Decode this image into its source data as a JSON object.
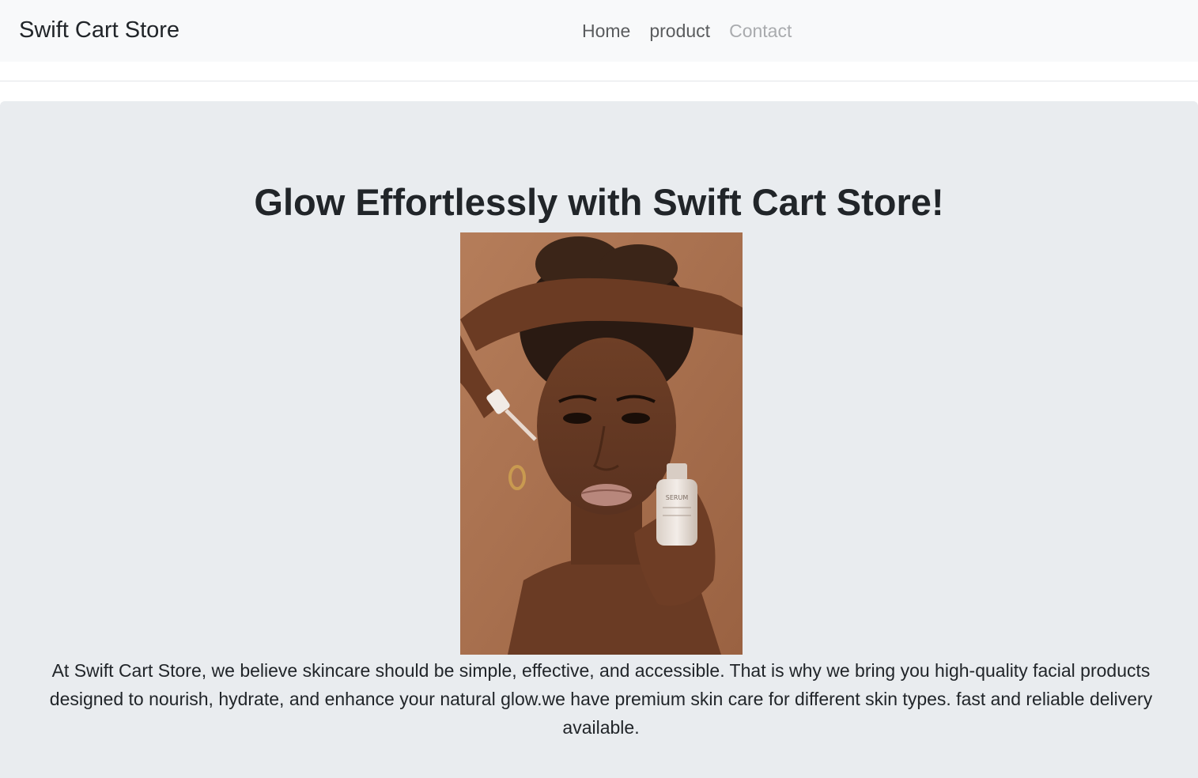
{
  "navbar": {
    "brand": "Swift Cart Store",
    "links": [
      {
        "label": "Home"
      },
      {
        "label": "product"
      },
      {
        "label": "Contact"
      }
    ]
  },
  "hero": {
    "title": "Glow Effortlessly with Swift Cart Store!",
    "image": {
      "subject": "woman-applying-facial-serum-photo",
      "bottle_label": "SERUM"
    },
    "description": "At Swift Cart Store, we believe skincare should be simple, effective, and accessible. That is why we bring you high-quality facial products designed to nourish, hydrate, and enhance your natural glow.we have premium skin care for different skin types. fast and reliable delivery available."
  },
  "colors": {
    "navbar_bg": "#f8f9fa",
    "hero_bg": "#e9ecef",
    "text": "#212529",
    "nav_link": "#5a5c5e",
    "nav_link_disabled": "#a9abae"
  }
}
